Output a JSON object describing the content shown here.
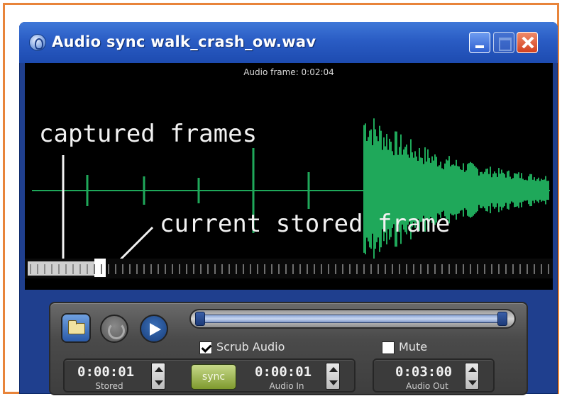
{
  "window": {
    "title": "Audio sync   walk_crash_ow.wav",
    "accent": "#2a5cc4",
    "frame_border_color": "#e8843a"
  },
  "waveform": {
    "frame_readout": "Audio frame: 0:02:04",
    "wave_color": "#1fa85a",
    "captured_label": "captured frames",
    "current_label": "current stored frame"
  },
  "controls": {
    "open_icon": "folder-open-icon",
    "loop_icon": "loop-icon",
    "play_icon": "play-icon",
    "scrub_audio_label": "Scrub Audio",
    "scrub_audio_checked": true,
    "mute_label": "Mute",
    "mute_checked": false,
    "sync_label": "sync",
    "stored_value": "0:00:01",
    "stored_caption": "Stored",
    "audio_in_value": "0:00:01",
    "audio_in_caption": "Audio In",
    "audio_out_value": "0:03:00",
    "audio_out_caption": "Audio Out"
  }
}
